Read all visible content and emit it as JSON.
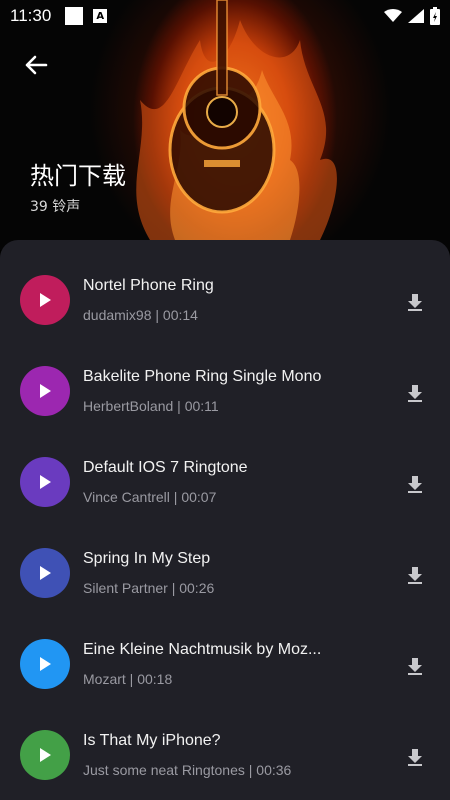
{
  "status_bar": {
    "time": "11:30",
    "a_badge": "A"
  },
  "header": {
    "title": "热门下载",
    "subtitle": "39 铃声"
  },
  "tracks": [
    {
      "title": "Nortel Phone Ring",
      "meta": "dudamix98 | 00:14",
      "color": "#c01d5c"
    },
    {
      "title": "Bakelite Phone Ring Single Mono",
      "meta": "HerbertBoland | 00:11",
      "color": "#9c27b0"
    },
    {
      "title": "Default IOS 7 Ringtone",
      "meta": "Vince Cantrell | 00:07",
      "color": "#6a3bbf"
    },
    {
      "title": "Spring In My Step",
      "meta": "Silent Partner | 00:26",
      "color": "#3f51b5"
    },
    {
      "title": "Eine Kleine Nachtmusik by Moz...",
      "meta": "Mozart | 00:18",
      "color": "#2196f3"
    },
    {
      "title": "Is That My iPhone?",
      "meta": "Just some neat Ringtones | 00:36",
      "color": "#43a047"
    }
  ],
  "icons": {
    "back": "arrow-left-icon",
    "play": "play-icon",
    "download": "download-icon",
    "wifi": "wifi-icon",
    "signal": "signal-icon",
    "battery": "battery-icon"
  }
}
